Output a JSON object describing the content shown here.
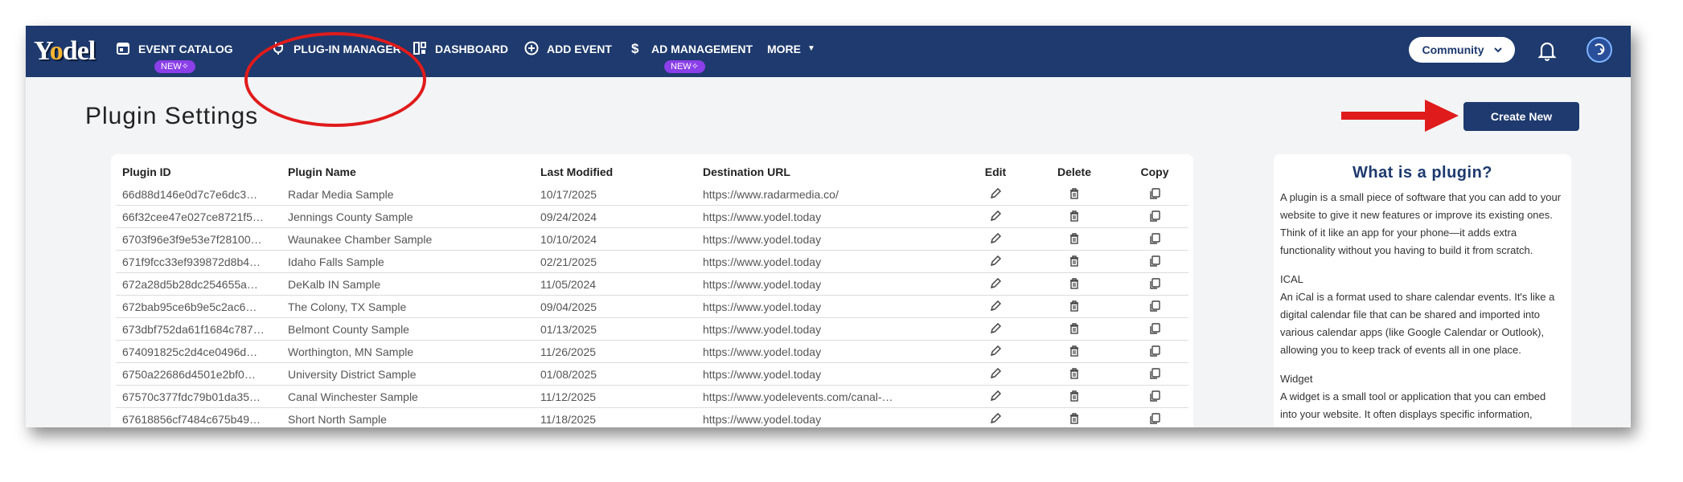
{
  "nav": {
    "logo": {
      "part1": "Y",
      "part2": "o",
      "part3": "del"
    },
    "items": [
      {
        "label": "EVENT CATALOG",
        "badge": "NEW✧",
        "icon": "calendar-icon"
      },
      {
        "label": "PLUG-IN MANAGER",
        "icon": "plug-icon"
      },
      {
        "label": "DASHBOARD",
        "icon": "dashboard-icon"
      },
      {
        "label": "ADD EVENT",
        "icon": "plus-circle-icon"
      },
      {
        "label": "AD MANAGEMENT",
        "badge": "NEW✧",
        "icon": "dollar-icon"
      },
      {
        "label": "MORE",
        "icon": "chevron-down-icon"
      }
    ],
    "community_label": "Community"
  },
  "page": {
    "title": "Plugin Settings",
    "create_button": "Create New"
  },
  "table": {
    "headers": {
      "id": "Plugin ID",
      "name": "Plugin Name",
      "modified": "Last Modified",
      "url": "Destination URL",
      "edit": "Edit",
      "delete": "Delete",
      "copy": "Copy"
    },
    "rows": [
      {
        "id": "66d88d146e0d7c7e6dc3…",
        "name": "Radar Media Sample",
        "modified": "10/17/2025",
        "url": "https://www.radarmedia.co/"
      },
      {
        "id": "66f32cee47e027ce8721f5…",
        "name": "Jennings County Sample",
        "modified": "09/24/2024",
        "url": "https://www.yodel.today"
      },
      {
        "id": "6703f96e3f9e53e7f28100…",
        "name": "Waunakee Chamber Sample",
        "modified": "10/10/2024",
        "url": "https://www.yodel.today"
      },
      {
        "id": "671f9fcc33ef939872d8b4…",
        "name": "Idaho Falls Sample",
        "modified": "02/21/2025",
        "url": "https://www.yodel.today"
      },
      {
        "id": "672a28d5b28dc254655a…",
        "name": "DeKalb IN Sample",
        "modified": "11/05/2024",
        "url": "https://www.yodel.today"
      },
      {
        "id": "672bab95ce6b9e5c2ac6…",
        "name": "The Colony, TX Sample",
        "modified": "09/04/2025",
        "url": "https://www.yodel.today"
      },
      {
        "id": "673dbf752da61f1684c787…",
        "name": "Belmont County Sample",
        "modified": "01/13/2025",
        "url": "https://www.yodel.today"
      },
      {
        "id": "674091825c2d4ce0496d…",
        "name": "Worthington, MN Sample",
        "modified": "11/26/2025",
        "url": "https://www.yodel.today"
      },
      {
        "id": "6750a22686d4501e2bf0…",
        "name": "University District Sample",
        "modified": "01/08/2025",
        "url": "https://www.yodel.today"
      },
      {
        "id": "67570c377fdc79b01da35…",
        "name": "Canal Winchester Sample",
        "modified": "11/12/2025",
        "url": "https://www.yodelevents.com/canal-…"
      },
      {
        "id": "67618856cf7484c675b49…",
        "name": "Short North Sample",
        "modified": "11/18/2025",
        "url": "https://www.yodel.today"
      }
    ]
  },
  "info": {
    "title": "What is a plugin?",
    "intro": "A plugin is a small piece of software that you can add to your website to give it new features or improve its existing ones. Think of it like an app for your phone—it adds extra functionality without you having to build it from scratch.",
    "ical_title": "ICAL",
    "ical_text": "An iCal is a format used to share calendar events. It's like a digital calendar file that can be shared and imported into various calendar apps (like Google Calendar or Outlook), allowing you to keep track of events all in one place.",
    "widget_title": "Widget",
    "widget_text": "A widget is a small tool or application that you can embed into your website. It often displays specific information,"
  },
  "colors": {
    "nav_bg": "#1e3a6e",
    "badge": "#8b3fe8",
    "annotation": "#e01b1b",
    "page_bg": "#f3f4f6"
  }
}
